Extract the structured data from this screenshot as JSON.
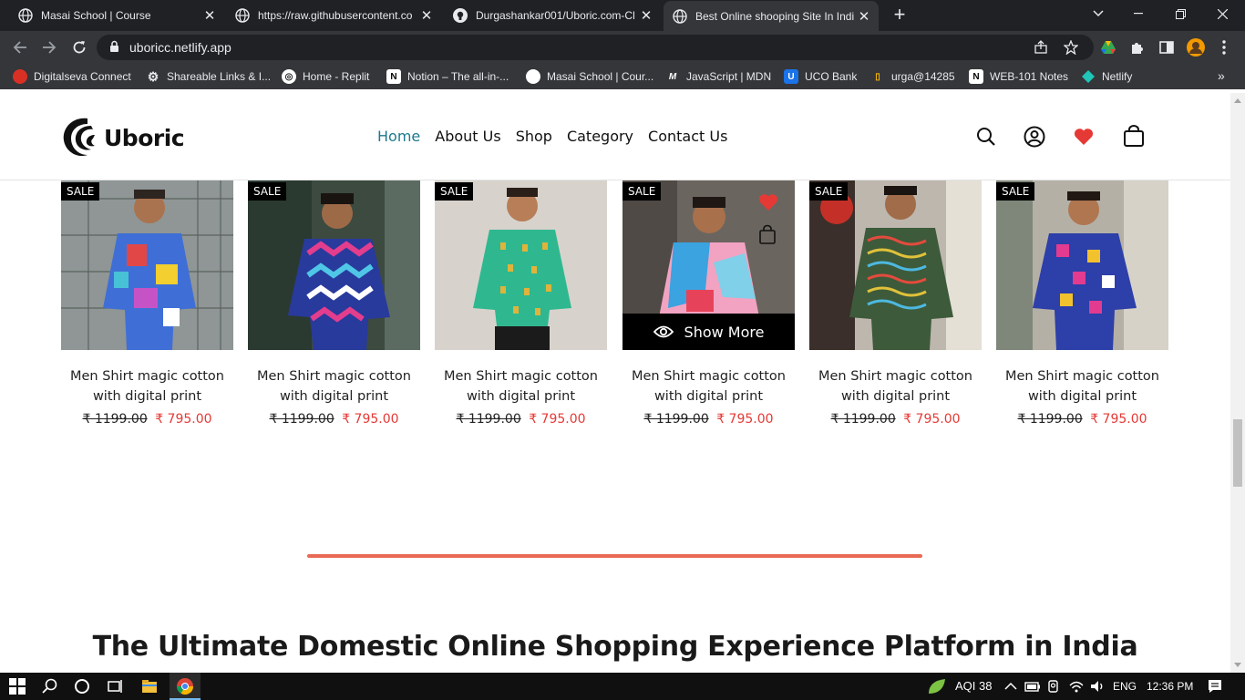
{
  "browser": {
    "tabs": [
      {
        "title": "Masai School | Course",
        "icon": "globe-icon",
        "active": false
      },
      {
        "title": "https://raw.githubusercontent.co",
        "icon": "globe-icon",
        "active": false
      },
      {
        "title": "Durgashankar001/Uboric.com-Cl",
        "icon": "github-icon",
        "active": false
      },
      {
        "title": "Best Online shooping Site In Indi",
        "icon": "globe-icon",
        "active": true
      }
    ],
    "new_tab": "+",
    "address": "uboricc.netlify.app",
    "bookmarks": [
      {
        "label": "Digitalseva Connect",
        "icon": "digitalseva-icon",
        "color": "#d93025"
      },
      {
        "label": "Shareable Links & I...",
        "icon": "gear-icon",
        "color": "#5f6368"
      },
      {
        "label": "Home - Replit",
        "icon": "replit-icon",
        "color": "#ffffff"
      },
      {
        "label": "Notion – The all-in-...",
        "icon": "notion-icon",
        "color": "#ffffff"
      },
      {
        "label": "Masai School | Cour...",
        "icon": "globe-icon",
        "color": "#ffffff"
      },
      {
        "label": "JavaScript | MDN",
        "icon": "mdn-icon",
        "color": "#ffffff"
      },
      {
        "label": "UCO Bank",
        "icon": "uco-bank-icon",
        "color": "#1a73e8"
      },
      {
        "label": "urga@14285",
        "icon": "bookmark-icon",
        "color": "#fbbc04"
      },
      {
        "label": "WEB-101 Notes",
        "icon": "notion-icon",
        "color": "#ffffff"
      },
      {
        "label": "Netlify",
        "icon": "netlify-icon",
        "color": "#20c6b7"
      }
    ],
    "bookmarks_more": "»"
  },
  "site": {
    "logo": "Uboric",
    "nav": [
      {
        "label": "Home",
        "active": true
      },
      {
        "label": "About Us",
        "active": false
      },
      {
        "label": "Shop",
        "active": false
      },
      {
        "label": "Category",
        "active": false
      },
      {
        "label": "Contact Us",
        "active": false
      }
    ],
    "accent": "#1c7a8c",
    "heart_color": "#e53935"
  },
  "products": [
    {
      "badge": "SALE",
      "name_line1": "Men Shirt magic cotton",
      "name_line2": "with digital print",
      "old_price": "₹ 1199.00",
      "new_price": "₹ 795.00"
    },
    {
      "badge": "SALE",
      "name_line1": "Men Shirt magic cotton",
      "name_line2": "with digital print",
      "old_price": "₹ 1199.00",
      "new_price": "₹ 795.00"
    },
    {
      "badge": "SALE",
      "name_line1": "Men Shirt magic cotton",
      "name_line2": "with digital print",
      "old_price": "₹ 1199.00",
      "new_price": "₹ 795.00"
    },
    {
      "badge": "SALE",
      "name_line1": "Men Shirt magic cotton",
      "name_line2": "with digital print",
      "old_price": "₹ 1199.00",
      "new_price": "₹ 795.00",
      "hover_action": "Show More"
    },
    {
      "badge": "SALE",
      "name_line1": "Men Shirt magic cotton",
      "name_line2": "with digital print",
      "old_price": "₹ 1199.00",
      "new_price": "₹ 795.00"
    },
    {
      "badge": "SALE",
      "name_line1": "Men Shirt magic cotton",
      "name_line2": "with digital print",
      "old_price": "₹ 1199.00",
      "new_price": "₹ 795.00"
    }
  ],
  "headline": "The Ultimate Domestic Online Shopping Experience Platform in India",
  "taskbar": {
    "weather": "AQI 38",
    "language": "ENG",
    "time": "12:36 PM"
  }
}
